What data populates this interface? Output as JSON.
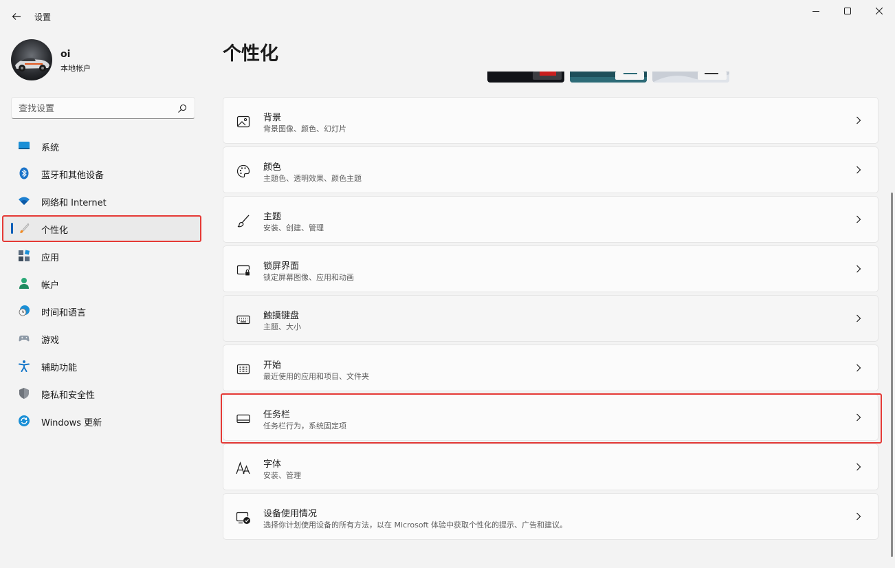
{
  "window": {
    "title": "设置",
    "icons": {
      "back": "back-arrow-icon",
      "minimize": "minimize-icon",
      "maximize": "maximize-icon",
      "close": "close-icon"
    }
  },
  "profile": {
    "name": "oi",
    "account_type": "本地帐户"
  },
  "search": {
    "placeholder": "查找设置"
  },
  "sidebar": {
    "items": [
      {
        "label": "系统",
        "icon": "system-icon"
      },
      {
        "label": "蓝牙和其他设备",
        "icon": "bluetooth-icon"
      },
      {
        "label": "网络和 Internet",
        "icon": "wifi-icon"
      },
      {
        "label": "个性化",
        "icon": "paintbrush-icon",
        "active": true
      },
      {
        "label": "应用",
        "icon": "apps-icon"
      },
      {
        "label": "帐户",
        "icon": "account-icon"
      },
      {
        "label": "时间和语言",
        "icon": "clock-globe-icon"
      },
      {
        "label": "游戏",
        "icon": "gamepad-icon"
      },
      {
        "label": "辅助功能",
        "icon": "accessibility-icon"
      },
      {
        "label": "隐私和安全性",
        "icon": "shield-icon"
      },
      {
        "label": "Windows 更新",
        "icon": "windows-update-icon"
      }
    ]
  },
  "main": {
    "title": "个性化",
    "cards": [
      {
        "title": "背景",
        "desc": "背景图像、颜色、幻灯片",
        "icon": "image-icon"
      },
      {
        "title": "颜色",
        "desc": "主题色、透明效果、颜色主题",
        "icon": "palette-icon"
      },
      {
        "title": "主题",
        "desc": "安装、创建、管理",
        "icon": "brush-icon"
      },
      {
        "title": "锁屏界面",
        "desc": "锁定屏幕图像、应用和动画",
        "icon": "lock-screen-icon"
      },
      {
        "title": "触摸键盘",
        "desc": "主题、大小",
        "icon": "keyboard-icon"
      },
      {
        "title": "开始",
        "desc": "最近使用的应用和项目、文件夹",
        "icon": "start-menu-icon"
      },
      {
        "title": "任务栏",
        "desc": "任务栏行为，系统固定项",
        "icon": "taskbar-icon"
      },
      {
        "title": "字体",
        "desc": "安装、管理",
        "icon": "font-icon"
      },
      {
        "title": "设备使用情况",
        "desc": "选择你计划使用设备的所有方法，以在 Microsoft 体验中获取个性化的提示、广告和建议。",
        "icon": "device-usage-icon"
      }
    ]
  },
  "colors": {
    "accent": "#005fb8",
    "highlight_box": "#e53935",
    "background": "#f3f3f3",
    "card": "#fbfbfb"
  }
}
